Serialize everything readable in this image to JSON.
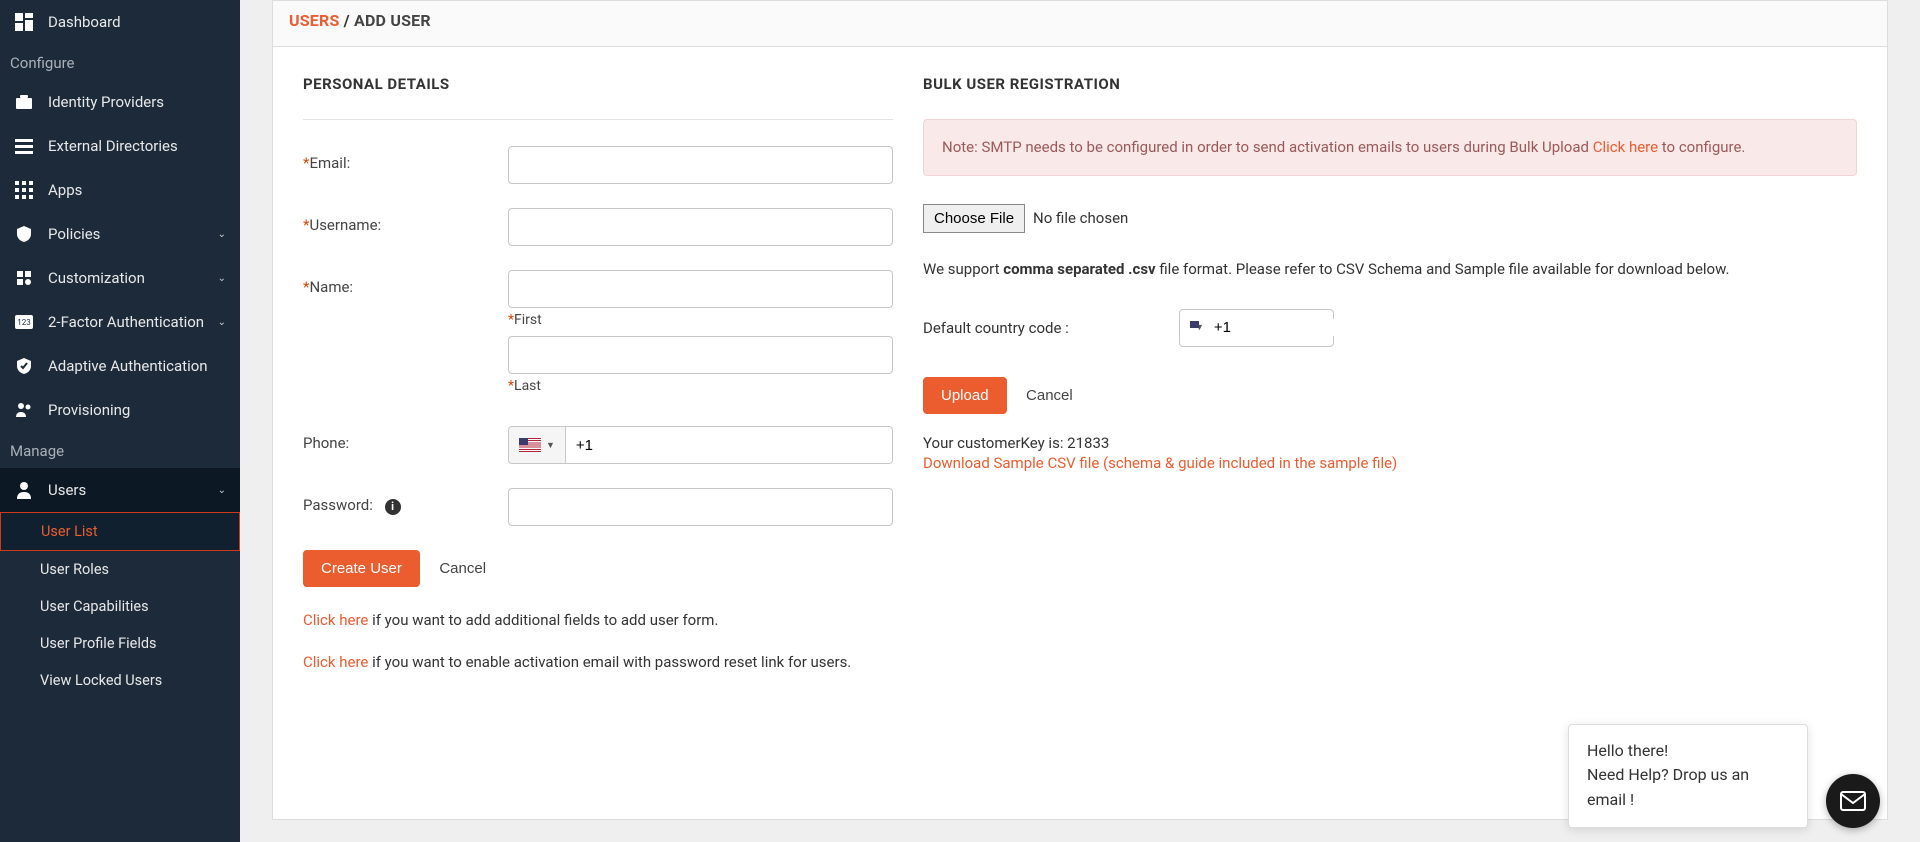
{
  "sidebar": {
    "dashboard": "Dashboard",
    "section_configure": "Configure",
    "identity_providers": "Identity Providers",
    "external_directories": "External Directories",
    "apps": "Apps",
    "policies": "Policies",
    "customization": "Customization",
    "two_factor": "2-Factor Authentication",
    "adaptive_auth": "Adaptive Authentication",
    "provisioning": "Provisioning",
    "section_manage": "Manage",
    "users": "Users",
    "user_list": "User List",
    "user_roles": "User Roles",
    "user_capabilities": "User Capabilities",
    "user_profile_fields": "User Profile Fields",
    "view_locked_users": "View Locked Users"
  },
  "breadcrumb": {
    "parent": "USERS",
    "sep": " / ",
    "current": "ADD USER"
  },
  "form": {
    "section_title": "PERSONAL DETAILS",
    "email_label": "Email:",
    "username_label": "Username:",
    "name_label": "Name:",
    "first_sub": "First",
    "last_sub": "Last",
    "phone_label": "Phone:",
    "phone_value": "+1",
    "password_label": "Password:",
    "create_btn": "Create User",
    "cancel_btn": "Cancel",
    "helper1_link": "Click here",
    "helper1_rest": " if you want to add additional fields to add user form.",
    "helper2_link": "Click here",
    "helper2_rest": " if you want to enable activation email with password reset link for users.",
    "email_value": "",
    "username_value": "",
    "first_value": "",
    "last_value": "",
    "password_value": ""
  },
  "bulk": {
    "section_title": "BULK USER REGISTRATION",
    "alert_pre": "Note: SMTP needs to be configured in order to send activation emails to users during Bulk Upload ",
    "alert_link": "Click here",
    "alert_post": " to configure.",
    "choose_file": "Choose File",
    "no_file": "No file chosen",
    "support_pre": "We support ",
    "support_bold": "comma separated .csv",
    "support_post": " file format. Please refer to CSV Schema and Sample file available for download below.",
    "country_label": "Default country code :",
    "country_value": "+1",
    "upload_btn": "Upload",
    "cancel_btn": "Cancel",
    "key_pre": "Your customerKey is: ",
    "key_val": "21833",
    "download_link": "Download Sample CSV file (schema & guide included in the sample file)"
  },
  "chat": {
    "line1": "Hello there!",
    "line2": "Need Help? Drop us an email !"
  }
}
